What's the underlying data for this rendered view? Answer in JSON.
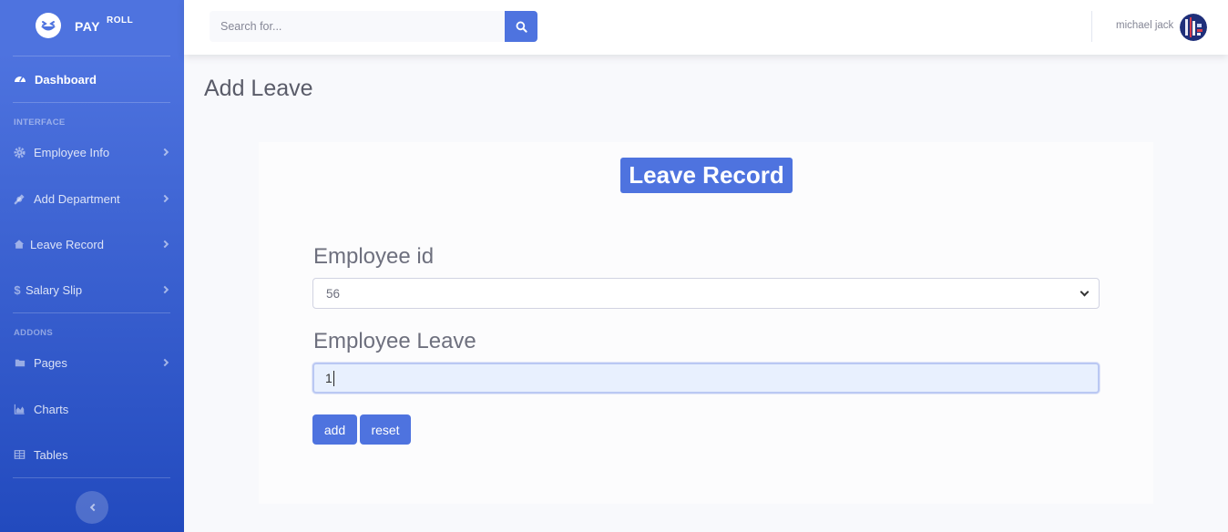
{
  "brand": {
    "name": "PAY",
    "sup": "ROLL",
    "logo_icon": "laughing-face-icon"
  },
  "sidebar": {
    "dashboard": {
      "label": "Dashboard",
      "icon": "tachometer-icon"
    },
    "heading_interface": "INTERFACE",
    "items_interface": [
      {
        "label": "Employee Info",
        "icon": "cog-icon"
      },
      {
        "label": "Add Department",
        "icon": "wrench-icon"
      },
      {
        "label": "Leave Record",
        "icon": "home-icon"
      },
      {
        "label": "Salary Slip",
        "icon": "dollar-icon"
      }
    ],
    "heading_addons": "ADDONS",
    "items_addons": [
      {
        "label": "Pages",
        "icon": "folder-icon"
      },
      {
        "label": "Charts",
        "icon": "area-chart-icon"
      },
      {
        "label": "Tables",
        "icon": "table-icon"
      }
    ]
  },
  "topbar": {
    "search_placeholder": "Search for...",
    "user_name": "michael jack"
  },
  "page": {
    "title": "Add Leave",
    "card_title": "Leave Record",
    "employee_id_label": "Employee id",
    "employee_id_value": "56",
    "employee_leave_label": "Employee Leave",
    "employee_leave_value": "1",
    "add_label": "add",
    "reset_label": "reset"
  },
  "colors": {
    "primary": "#4e73df",
    "sidebar_dark": "#224abe",
    "text_muted": "#858796"
  }
}
